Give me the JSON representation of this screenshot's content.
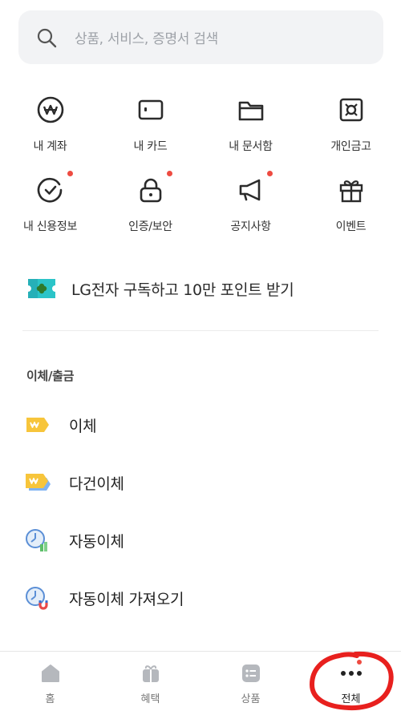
{
  "search": {
    "placeholder": "상품, 서비스, 증명서 검색"
  },
  "grid": [
    {
      "label": "내 계좌",
      "icon": "won-circle-icon",
      "dot": false
    },
    {
      "label": "내 카드",
      "icon": "card-icon",
      "dot": false
    },
    {
      "label": "내 문서함",
      "icon": "folder-icon",
      "dot": false
    },
    {
      "label": "개인금고",
      "icon": "safe-icon",
      "dot": false
    },
    {
      "label": "내 신용정보",
      "icon": "credit-check-icon",
      "dot": true
    },
    {
      "label": "인증/보안",
      "icon": "lock-icon",
      "dot": true
    },
    {
      "label": "공지사항",
      "icon": "megaphone-icon",
      "dot": true
    },
    {
      "label": "이벤트",
      "icon": "gift-icon",
      "dot": false
    }
  ],
  "promo": {
    "text": "LG전자 구독하고 10만 포인트 받기"
  },
  "section": {
    "title": "이체/출금"
  },
  "menu": [
    {
      "label": "이체"
    },
    {
      "label": "다건이체"
    },
    {
      "label": "자동이체"
    },
    {
      "label": "자동이체 가져오기"
    }
  ],
  "bottom_nav": [
    {
      "label": "홈"
    },
    {
      "label": "혜택"
    },
    {
      "label": "상품"
    },
    {
      "label": "전체"
    }
  ],
  "colors": {
    "accent_red": "#ee4b41",
    "ticket_yellow": "#f7c53b",
    "icon_dark": "#2b2b2b"
  }
}
